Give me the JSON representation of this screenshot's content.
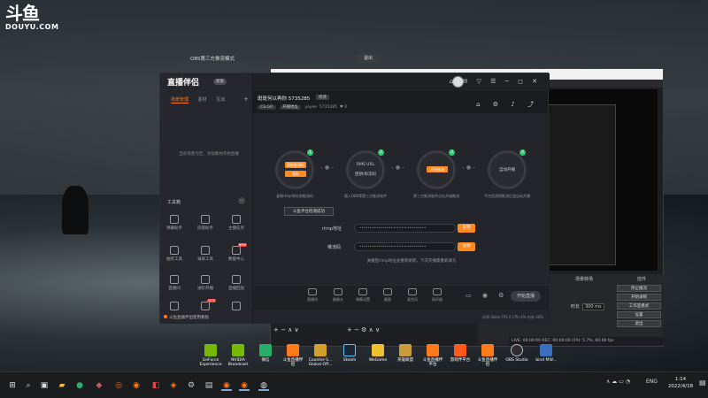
{
  "desktop": {
    "logo_mark": "斗鱼",
    "logo_url": "DOUYU.COM",
    "icons": [
      {
        "label": "GeForce\nExperience",
        "color": "#76b900"
      },
      {
        "label": "NVIDIA\nBroadcast",
        "color": "#76b900"
      },
      {
        "label": "微信",
        "color": "#2aae67"
      },
      {
        "label": "斗鱼直播伴\n侣",
        "color": "#ff7a1a"
      },
      {
        "label": "Counter-S...\nGlobal Off...",
        "color": "#d4a02b"
      },
      {
        "label": "Steam",
        "color": "#1b2838"
      },
      {
        "label": "WeGame",
        "color": "#f0c030"
      },
      {
        "label": "英雄联盟",
        "color": "#c89b3c"
      },
      {
        "label": "斗鱼直播伴\n平台",
        "color": "#ff7a1a"
      },
      {
        "label": "游戏伴平台",
        "color": "#ff5a1a"
      },
      {
        "label": "斗鱼直播伴\n侣",
        "color": "#ff7a1a"
      },
      {
        "label": "OBS Studio",
        "color": "#302e31"
      },
      {
        "label": "bind MW...",
        "color": "#3a6fbf"
      }
    ]
  },
  "app": {
    "brand": "直播伴侣",
    "brand_badge": "新版",
    "sidebar": {
      "tabs": [
        "场景管理",
        "素材",
        "互动"
      ],
      "empty_text": "当前场景为空，添加素材开始直播",
      "tools_title": "工具箱",
      "tools": [
        {
          "label": "弹幕助手"
        },
        {
          "label": "房管助手"
        },
        {
          "label": "主播任务"
        },
        {
          "label": "抽奖工具"
        },
        {
          "label": "录屏工具"
        },
        {
          "label": "数据中心",
          "tag": "NEW"
        },
        {
          "label": "直播间"
        },
        {
          "label": "进阶开播"
        },
        {
          "label": "直播回放"
        },
        {
          "label": "提醒"
        },
        {
          "label": "主播任务",
          "tag": "HOT"
        },
        {
          "label": "更多"
        }
      ],
      "footer": "斗鱼直播伴侣使用教程"
    },
    "room": {
      "title": "斑斑何以再你 5735285",
      "edit": "修改",
      "category": "CS:GO",
      "subcategory": "开播地址",
      "user": "yoyee",
      "room_id": "5735285",
      "likes": "0"
    },
    "panel": {
      "title": "OBS第三方推流模式",
      "exit_label": "退出",
      "steps": [
        {
          "num": "1",
          "btn1": "获取推流码",
          "btn2": "获取",
          "desc": "复制rtmp地址和推流码"
        },
        {
          "num": "2",
          "line1": "RMS URL",
          "line2": "密钥/串流码",
          "desc": "填入OBS等第三方推流软件"
        },
        {
          "num": "3",
          "btn1": "开始推流",
          "desc": "第三方推流软件点击开始推流"
        },
        {
          "num": "4",
          "line1": "自动开播",
          "desc": "平台检测到推流后会自动开播"
        }
      ],
      "tooltip": "斗鱼平台检测成功",
      "rtmp_label": "rtmp地址",
      "rtmp_value": "••••••••••••••••••••••••••••••••",
      "key_label": "推流码",
      "key_value": "••••••••••••••••••••••••••••••••",
      "copy_label": "复制",
      "notice": "关播后rtmp地址会重新刷新，下次开播需重新填写"
    },
    "bottom_tools": [
      {
        "label": "直播间"
      },
      {
        "label": "摄像头"
      },
      {
        "label": "弹幕设置"
      },
      {
        "label": "截图"
      },
      {
        "label": "麦克风"
      },
      {
        "label": "扬声器"
      }
    ],
    "live_button": "开始直播",
    "status_text": "码率 0kb/s   FPS 0   CPU 4%   内存 30%"
  },
  "obs": {
    "scene_header": "场景转场",
    "controls_header": "控件",
    "duration_label": "时长",
    "duration_value": "300 ms",
    "buttons": [
      "停止推流",
      "开始录制",
      "工作室模式",
      "设置",
      "退出"
    ],
    "status": "LIVE: 00:00:00   REC: 00:00:00   CPU: 5.7%, 60.00 fps"
  },
  "taskbar": {
    "lang": "ENG",
    "time": "1:14",
    "date": "2022/4/18"
  }
}
